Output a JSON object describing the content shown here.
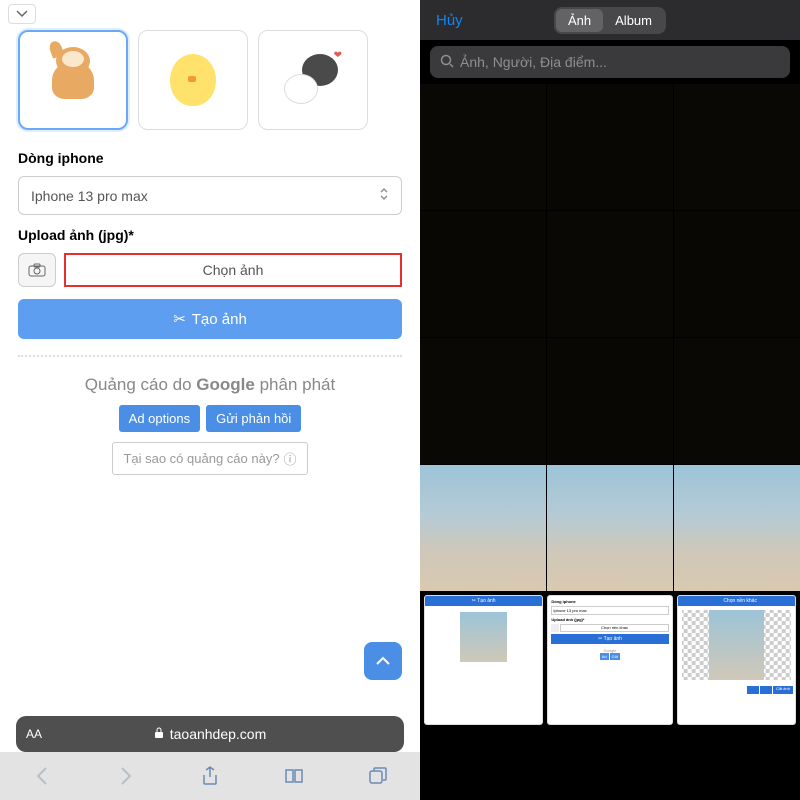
{
  "left": {
    "dong_label": "Dòng iphone",
    "phone_model": "Iphone 13 pro max",
    "upload_label": "Upload ảnh (jpg)*",
    "choose_btn": "Chọn ảnh",
    "create_btn": "Tạo ảnh",
    "ad": {
      "prefix": "Quảng cáo do ",
      "brand": "Google",
      "suffix": " phân phát",
      "opt_label": "Ad options",
      "feedback_label": "Gửi phản hồi",
      "why_label": "Tại sao có quảng cáo này?"
    },
    "safari_domain": "taoanhdep.com"
  },
  "right": {
    "cancel": "Hủy",
    "seg_photos": "Ảnh",
    "seg_albums": "Album",
    "search_placeholder": "Ảnh, Người, Địa điểm...",
    "mini": {
      "tao_anh": "Tạo ảnh",
      "dong": "Dòng iphone",
      "model": "Iphone 13 pro max",
      "upload": "Upload ảnh (jpg)*",
      "chon_nen": "Chọn nền khác",
      "cat_anh": "Cắt ảnh"
    }
  }
}
